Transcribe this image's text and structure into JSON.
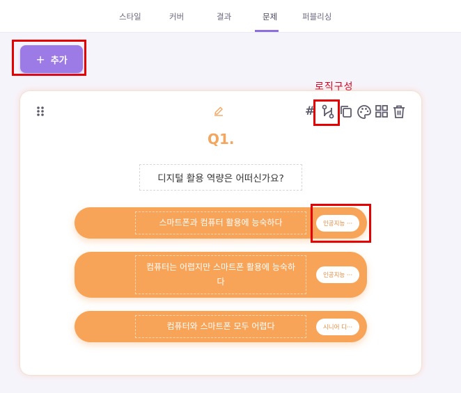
{
  "tabs": [
    "스타일",
    "커버",
    "결과",
    "문제",
    "퍼블리싱"
  ],
  "add_button": {
    "plus": "+",
    "label": "추가"
  },
  "annotation": {
    "logic": "로직구성"
  },
  "toolbar": {
    "hash": "#"
  },
  "question": {
    "number": "Q1.",
    "title": "디지털 활용 역량은 어떠신가요?",
    "options": [
      {
        "text": "스마트폰과 컴퓨터  활용에 능숙하다",
        "result": "인공지능 ···"
      },
      {
        "text": "컴퓨터는 어렵지만 스마트폰 활용에 능숙하다",
        "result": "인공지능 ···"
      },
      {
        "text": "컴퓨터와 스마트폰 모두 어렵다",
        "result": "시니어 디···"
      }
    ]
  },
  "colors": {
    "accent": "#9d7be6",
    "option": "#f8a458",
    "qnum": "#f2a660",
    "annotation": "#e60000"
  }
}
